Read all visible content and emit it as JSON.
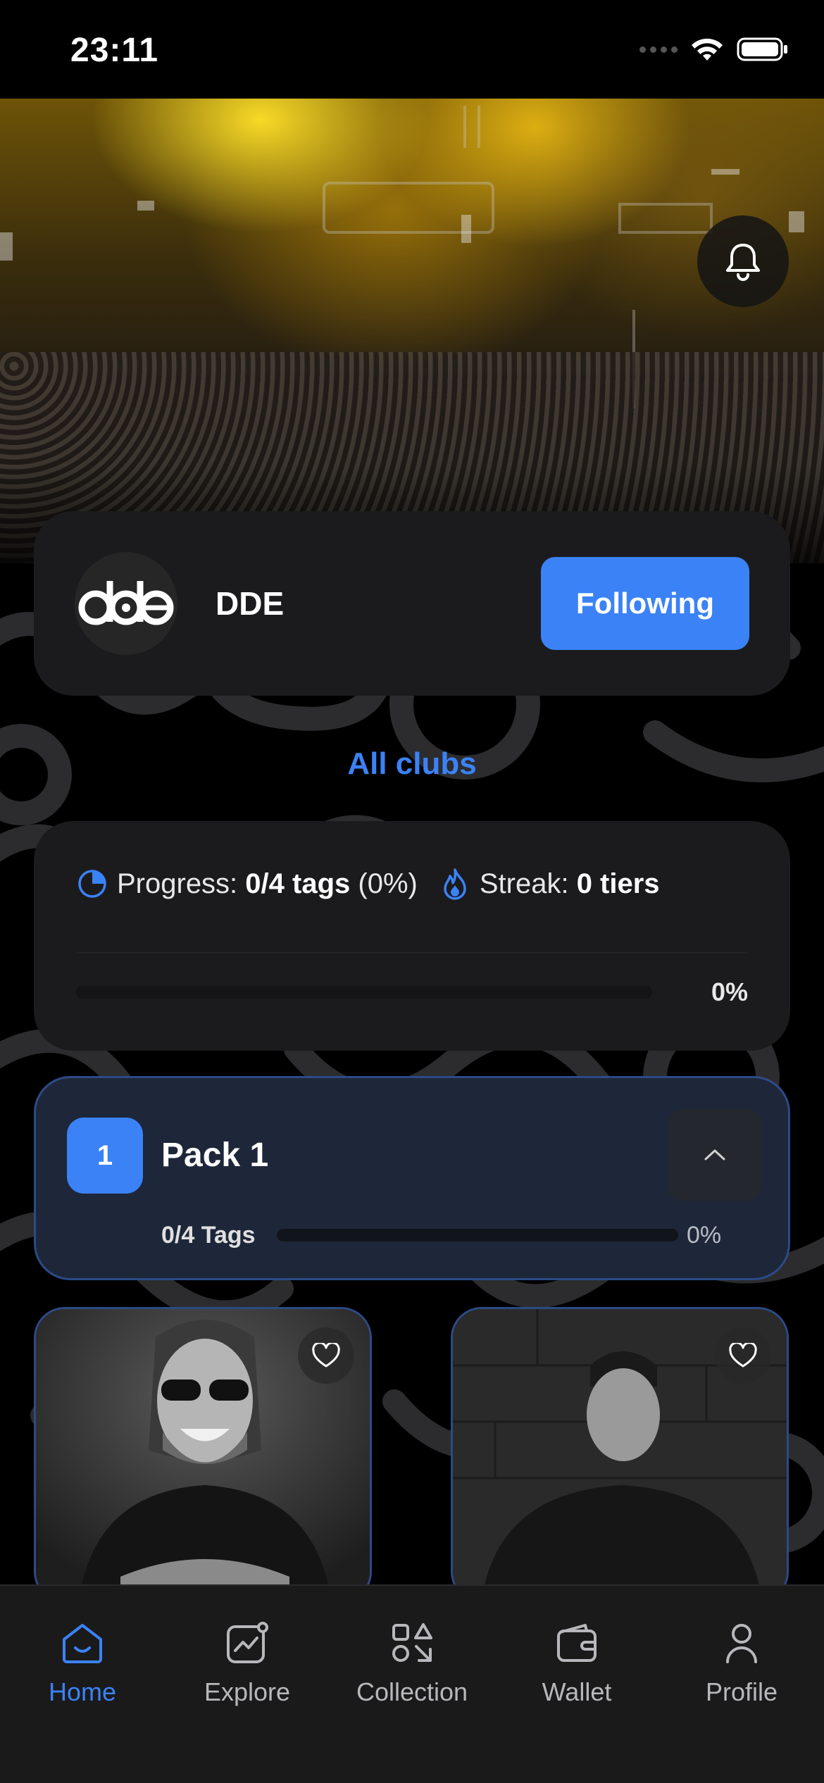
{
  "status_bar": {
    "time": "23:11"
  },
  "club": {
    "name": "DDE",
    "follow_label": "Following",
    "all_clubs_label": "All clubs"
  },
  "progress": {
    "progress_label": "Progress:",
    "tags_value": "0/4 tags",
    "tags_percent": "(0%)",
    "streak_label": "Streak:",
    "streak_value": "0 tiers",
    "bar_percent": "0%",
    "fraction": 0
  },
  "pack": {
    "badge": "1",
    "title": "Pack 1",
    "tags": "0/4 Tags",
    "percent": "0%",
    "fraction": 0
  },
  "artists": [
    {
      "icon": "heart-icon"
    },
    {
      "icon": "heart-icon"
    }
  ],
  "tab_bar": {
    "items": [
      {
        "label": "Home",
        "icon": "home-icon",
        "active": true
      },
      {
        "label": "Explore",
        "icon": "explore-chart-icon",
        "active": false
      },
      {
        "label": "Collection",
        "icon": "collection-shapes-icon",
        "active": false
      },
      {
        "label": "Wallet",
        "icon": "wallet-icon",
        "active": false
      },
      {
        "label": "Profile",
        "icon": "profile-icon",
        "active": false
      }
    ]
  },
  "colors": {
    "accent": "#3b82f6",
    "card": "#1b1b1d",
    "pack_card": "#1e2739"
  }
}
